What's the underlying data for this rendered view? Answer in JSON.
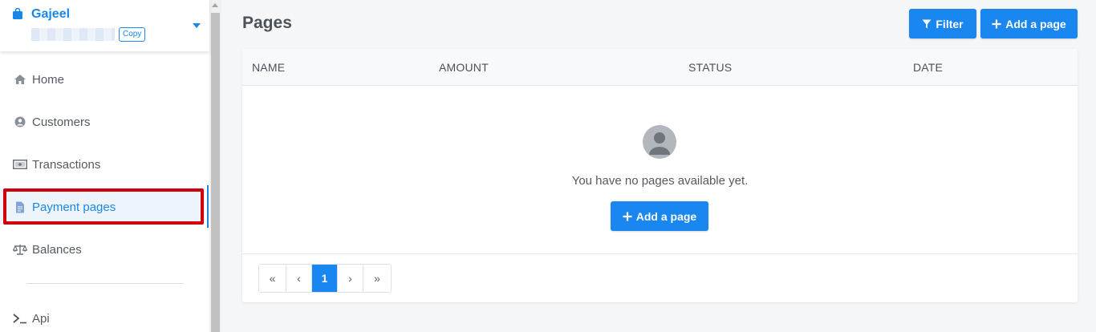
{
  "sidebar": {
    "brand": {
      "name": "Gajeel",
      "copy_label": "Copy"
    },
    "items": [
      {
        "label": "Home",
        "icon": "home-icon"
      },
      {
        "label": "Customers",
        "icon": "user-circle-icon"
      },
      {
        "label": "Transactions",
        "icon": "money-bill-icon"
      },
      {
        "label": "Payment pages",
        "icon": "file-icon",
        "active": true
      },
      {
        "label": "Balances",
        "icon": "balance-scale-icon"
      },
      {
        "label": "Api",
        "icon": "terminal-icon"
      }
    ]
  },
  "header": {
    "title": "Pages",
    "filter_label": "Filter",
    "add_label": "Add a page"
  },
  "table": {
    "columns": [
      "NAME",
      "AMOUNT",
      "STATUS",
      "DATE"
    ],
    "rows": []
  },
  "empty_state": {
    "message": "You have no pages available yet.",
    "button_label": "Add a page"
  },
  "pagination": {
    "first": "«",
    "prev": "‹",
    "current": "1",
    "next": "›",
    "last": "»"
  },
  "colors": {
    "accent": "#1a87f0",
    "highlight": "#d0000a"
  }
}
